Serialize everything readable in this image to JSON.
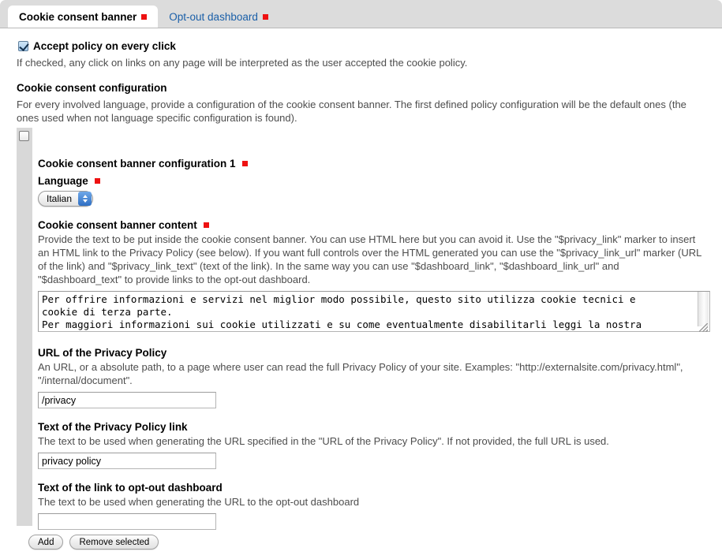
{
  "tabs": [
    {
      "label": "Cookie consent banner",
      "active": true,
      "required": true
    },
    {
      "label": "Opt-out dashboard",
      "active": false,
      "required": true
    }
  ],
  "accept_policy": {
    "label": "Accept policy on every click",
    "checked": true,
    "help": "If checked, any click on links on any page will be interpreted as the user accepted the cookie policy."
  },
  "configuration_section": {
    "title": "Cookie consent configuration",
    "description": "For every involved language, provide a configuration of the cookie consent banner. The first defined policy configuration will be the default ones (the ones used when not language specific configuration is found)."
  },
  "config_block": {
    "select_checkbox_checked": false,
    "title": "Cookie consent banner configuration 1",
    "language": {
      "label": "Language",
      "value": "Italian",
      "options": [
        "Italian"
      ]
    },
    "content": {
      "label": "Cookie consent banner content",
      "description": "Provide the text to be put inside the cookie consent banner. You can use HTML here but you can avoid it. Use the \"$privacy_link\" marker to insert an HTML link to the Privacy Policy (see below). If you want full controls over the HTML generated you can use the \"$privacy_link_url\" marker (URL of the link) and \"$privacy_link_text\" (text of the link). In the same way you can use \"$dashboard_link\", \"$dashboard_link_url\" and \"$dashboard_text\" to provide links to the opt-out dashboard.",
      "value": "Per offrire informazioni e servizi nel miglior modo possibile, questo sito utilizza cookie tecnici e\ncookie di terza parte.\nPer maggiori informazioni sui cookie utilizzati e su come eventualmente disabilitarli leggi la nostra"
    },
    "privacy_url": {
      "label": "URL of the Privacy Policy",
      "description": "An URL, or a absolute path, to a page where user can read the full Privacy Policy of your site. Examples: \"http://externalsite.com/privacy.html\", \"/internal/document\".",
      "value": "/privacy"
    },
    "privacy_link_text": {
      "label": "Text of the Privacy Policy link",
      "description": "The text to be used when generating the URL specified in the \"URL of the Privacy Policy\". If not provided, the full URL is used.",
      "value": "privacy policy"
    },
    "dashboard_link_text": {
      "label": "Text of the link to opt-out dashboard",
      "description": "The text to be used when generating the URL to the opt-out dashboard",
      "value": ""
    }
  },
  "actions": {
    "add": "Add",
    "remove_selected": "Remove selected"
  },
  "colors": {
    "required_marker": "#ee1111",
    "tab_link": "#1a5fa8",
    "gutter": "#d8d8d8",
    "tabbar": "#dcdcdc"
  }
}
